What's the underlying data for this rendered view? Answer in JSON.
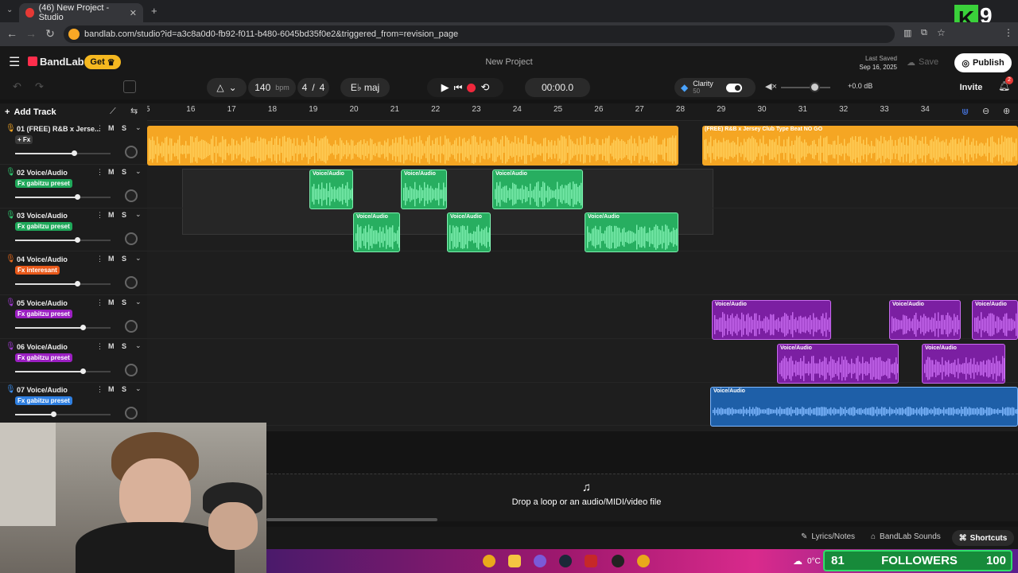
{
  "browser": {
    "tab_title": "(46) New Project - Studio",
    "url": "bandlab.com/studio?id=a3c8a0d0-fb92-f011-b480-6045bd35f0e2&triggered_from=revision_page"
  },
  "header": {
    "brand": "BandLab",
    "get_label": "Get",
    "project_title": "New Project",
    "last_saved_label": "Last Saved",
    "last_saved_date": "Sep 16, 2025",
    "save_label": "Save",
    "publish_label": "Publish",
    "invite_label": "Invite",
    "notification_count": "2"
  },
  "transport": {
    "tempo": "140",
    "tempo_unit": "bpm",
    "time_sig_num": "4",
    "time_sig_sep": "/",
    "time_sig_den": "4",
    "key": "E♭ maj",
    "time": "00:00.0",
    "clarity_label": "Clarity",
    "clarity_value": "50",
    "volume_db": "+0.0 dB"
  },
  "toolbar": {
    "add_track_label": "Add Track"
  },
  "ruler": {
    "bars": [
      "15",
      "16",
      "17",
      "18",
      "19",
      "20",
      "21",
      "22",
      "23",
      "24",
      "25",
      "26",
      "27",
      "28",
      "29",
      "30",
      "31",
      "32",
      "33",
      "34"
    ]
  },
  "tracks": [
    {
      "name": "01  (FREE) R&B x Jerse...",
      "fx": "+ Fx",
      "fx_color": "#3a3a3a",
      "icon_color": "#f5a623",
      "volume": 0.62
    },
    {
      "name": "02  Voice/Audio",
      "fx": "Fx gabitzu preset",
      "fx_color": "#1fa85a",
      "icon_color": "#2ecc71",
      "volume": 0.65
    },
    {
      "name": "03  Voice/Audio",
      "fx": "Fx gabitzu preset",
      "fx_color": "#1fa85a",
      "icon_color": "#2ecc71",
      "volume": 0.65
    },
    {
      "name": "04  Voice/Audio",
      "fx": "Fx interesant",
      "fx_color": "#e8591a",
      "icon_color": "#ef6c1a",
      "volume": 0.65
    },
    {
      "name": "05  Voice/Audio",
      "fx": "Fx gabitzu preset",
      "fx_color": "#9b1fc2",
      "icon_color": "#a23ad6",
      "volume": 0.71
    },
    {
      "name": "06  Voice/Audio",
      "fx": "Fx gabitzu preset",
      "fx_color": "#9b1fc2",
      "icon_color": "#a23ad6",
      "volume": 0.71
    },
    {
      "name": "07  Voice/Audio",
      "fx": "Fx gabitzu preset",
      "fx_color": "#2f7fe0",
      "icon_color": "#3a8ef0",
      "volume": 0.4
    }
  ],
  "track_controls": {
    "mute": "M",
    "solo": "S"
  },
  "clips": {
    "beat_label": "(FREE) R&B x Jersey Club Type Beat NO GO",
    "voice_label": "Voice/Audio"
  },
  "drop_zone": {
    "text": "Drop a loop or an audio/MIDI/video file"
  },
  "bottom": {
    "lyrics_label": "Lyrics/Notes",
    "sounds_label": "BandLab Sounds",
    "shortcuts_label": "Shortcuts"
  },
  "overlay": {
    "followers_count": "81",
    "followers_label": "FOLLOWERS",
    "followers_goal": "100",
    "weather": "0°C",
    "logo": "K9"
  },
  "colors": {
    "beat": "#f5a623",
    "green": "#27ae60",
    "purple": "#7b1fa2",
    "blue": "#1e5fa8"
  }
}
